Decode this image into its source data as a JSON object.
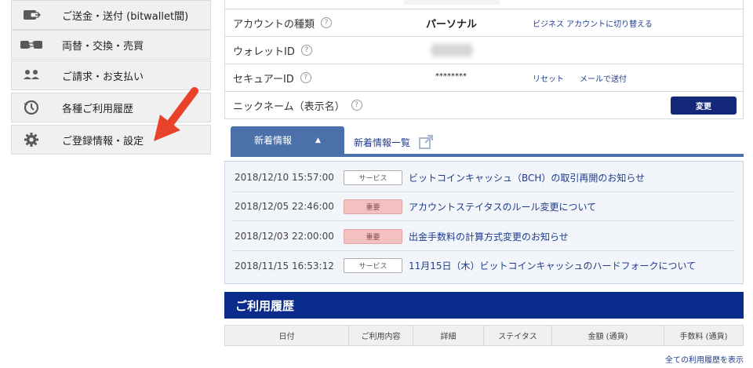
{
  "sidebar": {
    "items": [
      {
        "label": "ご送金・送付 (bitwallet間)",
        "icon": "wallet-send-icon"
      },
      {
        "label": "両替・交換・売買",
        "icon": "exchange-icon"
      },
      {
        "label": "ご請求・お支払い",
        "icon": "users-icon"
      },
      {
        "label": "各種ご利用履歴",
        "icon": "history-clock-icon"
      },
      {
        "label": "ご登録情報・設定",
        "icon": "gear-icon"
      }
    ]
  },
  "account": {
    "help_glyph": "?",
    "type_label": "アカウントの種類",
    "type_value": "パーソナル",
    "switch_link": "ビジネス アカウントに切り替える",
    "wallet_id_label": "ウォレットID",
    "secure_id_label": "セキュアーID",
    "secure_id_value": "********",
    "reset_link": "リセット",
    "email_link": "メールで送付",
    "nickname_label": "ニックネーム（表示名）",
    "change_button": "変更"
  },
  "news": {
    "tab_active": "新着情報",
    "tab_chevron": "▲",
    "tab_all": "新着情報一覧",
    "items": [
      {
        "date": "2018/12/10 15:57:00",
        "badge": "サービス",
        "badge_type": "service",
        "title": "ビットコインキャッシュ（BCH）の取引再開のお知らせ"
      },
      {
        "date": "2018/12/05 22:46:00",
        "badge": "重要",
        "badge_type": "important",
        "title": "アカウントステイタスのルール変更について"
      },
      {
        "date": "2018/12/03 22:00:00",
        "badge": "重要",
        "badge_type": "important",
        "title": "出金手数料の計算方式変更のお知らせ"
      },
      {
        "date": "2018/11/15 16:53:12",
        "badge": "サービス",
        "badge_type": "service",
        "title": "11月15日（木）ビットコインキャッシュのハードフォークについて"
      }
    ]
  },
  "history": {
    "title": "ご利用履歴",
    "columns": [
      "日付",
      "ご利用内容",
      "詳細",
      "ステイタス",
      "金額 (通貨)",
      "手数料 (通貨)"
    ],
    "all_link": "全ての利用履歴を表示"
  },
  "colors": {
    "accent_navy": "#0a2a8c",
    "tab_blue": "#4b70aa",
    "link_blue": "#1f3c8c",
    "arrow_red": "#e8432a",
    "important_badge": "#f3c1c1"
  }
}
